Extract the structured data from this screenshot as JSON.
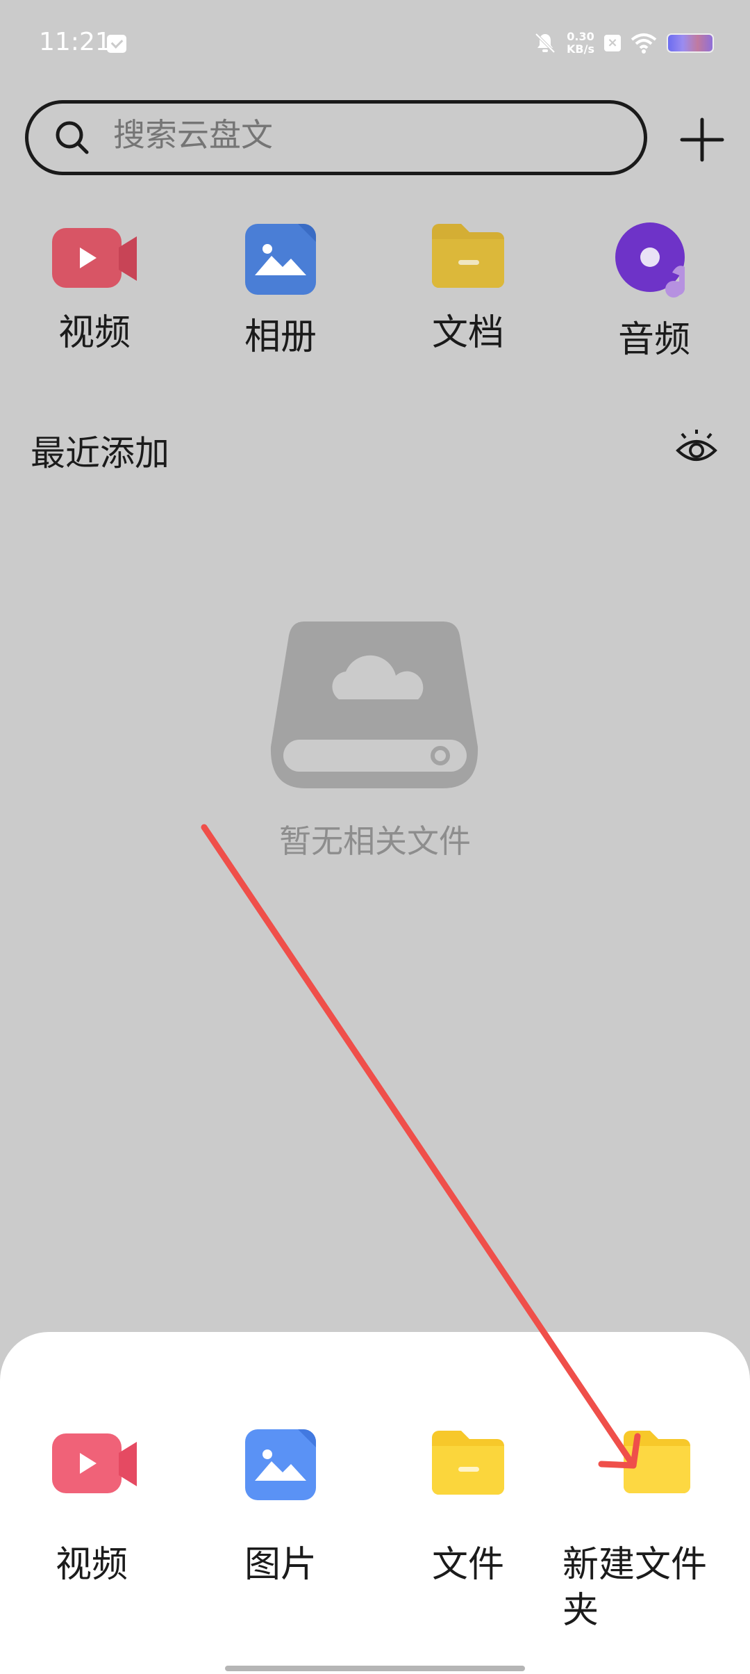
{
  "status_bar": {
    "time": "11:21",
    "net_speed_value": "0.30",
    "net_speed_unit": "KB/s"
  },
  "search": {
    "placeholder": "搜索云盘文"
  },
  "categories": [
    {
      "label": "视频",
      "icon": "video-icon"
    },
    {
      "label": "相册",
      "icon": "album-icon"
    },
    {
      "label": "文档",
      "icon": "document-folder-icon"
    },
    {
      "label": "音频",
      "icon": "audio-icon"
    }
  ],
  "recent": {
    "title": "最近添加",
    "empty_text": "暂无相关文件"
  },
  "sheet": {
    "items": [
      {
        "label": "视频",
        "icon": "video-icon"
      },
      {
        "label": "图片",
        "icon": "image-icon"
      },
      {
        "label": "文件",
        "icon": "file-folder-icon"
      },
      {
        "label_line1": "新建文件",
        "label_line2": "夹",
        "icon": "new-folder-icon"
      }
    ]
  },
  "colors": {
    "overlay_bg": "#cbcbcb",
    "sheet_bg": "#ffffff",
    "video_red": "#e9566a",
    "album_blue": "#4a86e8",
    "doc_yellow": "#f5c830",
    "audio_purple": "#7b3fe0",
    "arrow_red": "#ef4f4a"
  }
}
